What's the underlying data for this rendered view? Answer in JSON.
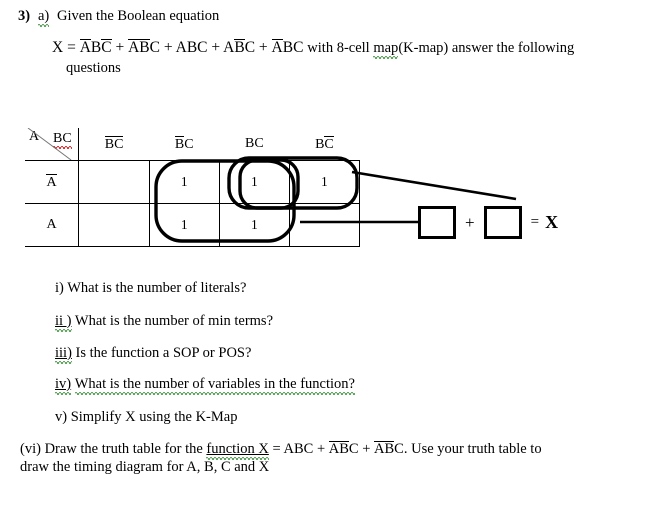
{
  "header": {
    "question_number": "3)",
    "part_label": "a)",
    "prompt": "Given the Boolean equation",
    "equation": {
      "lhs": "X =",
      "terms": [
        {
          "vars": [
            {
              "ch": "A",
              "bar": true
            },
            {
              "ch": "B",
              "bar": false
            },
            {
              "ch": "C",
              "bar": true
            }
          ]
        },
        {
          "vars": [
            {
              "ch": "A",
              "bar": true
            },
            {
              "ch": "B",
              "bar": true
            },
            {
              "ch": "C",
              "bar": false
            }
          ]
        },
        {
          "vars": [
            {
              "ch": "A",
              "bar": false
            },
            {
              "ch": "B",
              "bar": false
            },
            {
              "ch": "C",
              "bar": false
            }
          ]
        },
        {
          "vars": [
            {
              "ch": "A",
              "bar": false
            },
            {
              "ch": "B",
              "bar": true
            },
            {
              "ch": "C",
              "bar": false
            }
          ]
        },
        {
          "vars": [
            {
              "ch": "A",
              "bar": true
            },
            {
              "ch": "B",
              "bar": false
            },
            {
              "ch": "C",
              "bar": false
            }
          ]
        }
      ],
      "plus": "+",
      "tail_before_map": "with 8-cell ",
      "tail_map_word": "map",
      "tail_after_map": "(K-map) answer the following"
    },
    "questions_word": "questions"
  },
  "kmap": {
    "corner": {
      "row_var": "A",
      "col_vars": "BC"
    },
    "col_headers": [
      {
        "id": "col-b0c0",
        "vars": [
          {
            "ch": "B",
            "bar": true
          },
          {
            "ch": "C",
            "bar": true
          }
        ]
      },
      {
        "id": "col-b0c1",
        "vars": [
          {
            "ch": "B",
            "bar": true
          },
          {
            "ch": "C",
            "bar": false
          }
        ]
      },
      {
        "id": "col-b1c1",
        "vars": [
          {
            "ch": "B",
            "bar": false
          },
          {
            "ch": "C",
            "bar": false
          }
        ]
      },
      {
        "id": "col-b1c0",
        "vars": [
          {
            "ch": "B",
            "bar": false
          },
          {
            "ch": "C",
            "bar": true
          }
        ]
      }
    ],
    "rows": [
      {
        "id": "row-abar",
        "label_ch": "A",
        "label_bar": true,
        "cells": [
          "",
          "1",
          "1",
          "1"
        ]
      },
      {
        "id": "row-a",
        "label_ch": "A",
        "label_bar": false,
        "cells": [
          "",
          "1",
          "1",
          ""
        ]
      }
    ],
    "groups": [
      {
        "name": "group-four-cells",
        "cells": "columns 2-3, both rows"
      },
      {
        "name": "group-two-cells-top-middle",
        "cells": "row 1 column 3"
      },
      {
        "name": "group-two-cells-top-right",
        "cells": "row 1 columns 3-4"
      }
    ]
  },
  "answer": {
    "box1_value": "",
    "box2_value": "",
    "plus": "+",
    "equals": "=",
    "result_var": "X"
  },
  "questions": [
    {
      "id": "q-i",
      "marker": "i)",
      "marker_squiggle": "none",
      "text": "What is the number of literals?"
    },
    {
      "id": "q-ii",
      "marker": "ii )",
      "marker_squiggle": "green",
      "text": "What is the number of min terms?"
    },
    {
      "id": "q-iii",
      "marker": "iii)",
      "marker_squiggle": "green",
      "text": "Is the function a SOP or POS?"
    },
    {
      "id": "q-iv",
      "marker": "iv)",
      "marker_squiggle": "green",
      "text": "What is the number of variables in the function?"
    },
    {
      "id": "q-v",
      "marker": "v)",
      "marker_squiggle": "none",
      "text": "Simplify X using the K-Map"
    }
  ],
  "question_vi": {
    "marker": "(vi)",
    "text_before": "Draw the truth table for the ",
    "underlined_phrase": "function  X",
    "equation": {
      "equals": "=",
      "terms": [
        {
          "vars": [
            {
              "ch": "A",
              "bar": false
            },
            {
              "ch": "B",
              "bar": false
            },
            {
              "ch": "C",
              "bar": false
            }
          ]
        },
        {
          "vars": [
            {
              "ch": "A",
              "bar": true
            },
            {
              "ch": "B",
              "bar": true
            },
            {
              "ch": "C",
              "bar": false
            }
          ]
        },
        {
          "vars": [
            {
              "ch": "A",
              "bar": true
            },
            {
              "ch": "B",
              "bar": true
            },
            {
              "ch": "C",
              "bar": false
            }
          ]
        }
      ],
      "plus": "+"
    },
    "text_after": ". Use your truth table to",
    "line2": "draw the timing diagram for A, B, C and X"
  },
  "colors": {
    "text": "#000000",
    "grid_line": "#000000",
    "group_outline": "#000000",
    "spell_green": "#2e8b2e",
    "spell_red": "#c00000"
  }
}
